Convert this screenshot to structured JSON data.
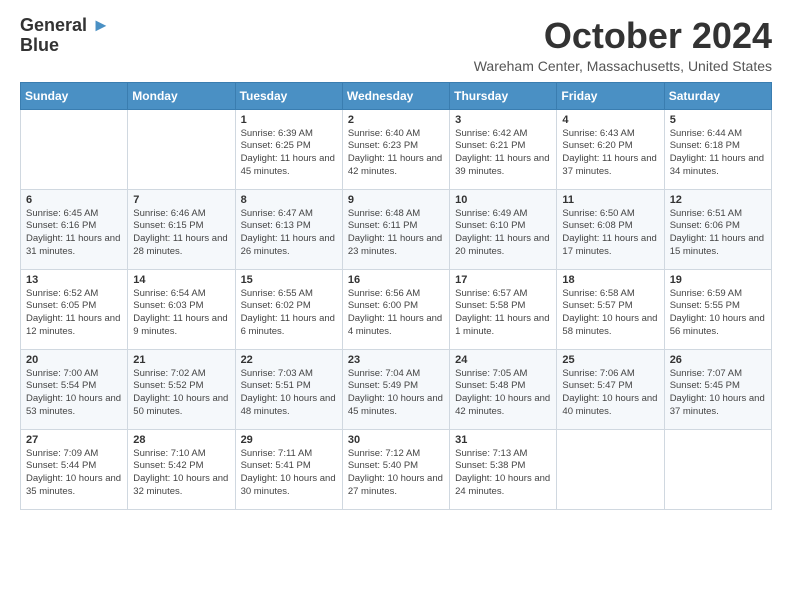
{
  "header": {
    "logo_line1": "General",
    "logo_line2": "Blue",
    "month": "October 2024",
    "location": "Wareham Center, Massachusetts, United States"
  },
  "days_of_week": [
    "Sunday",
    "Monday",
    "Tuesday",
    "Wednesday",
    "Thursday",
    "Friday",
    "Saturday"
  ],
  "weeks": [
    [
      {
        "day": "",
        "info": ""
      },
      {
        "day": "",
        "info": ""
      },
      {
        "day": "1",
        "info": "Sunrise: 6:39 AM\nSunset: 6:25 PM\nDaylight: 11 hours and 45 minutes."
      },
      {
        "day": "2",
        "info": "Sunrise: 6:40 AM\nSunset: 6:23 PM\nDaylight: 11 hours and 42 minutes."
      },
      {
        "day": "3",
        "info": "Sunrise: 6:42 AM\nSunset: 6:21 PM\nDaylight: 11 hours and 39 minutes."
      },
      {
        "day": "4",
        "info": "Sunrise: 6:43 AM\nSunset: 6:20 PM\nDaylight: 11 hours and 37 minutes."
      },
      {
        "day": "5",
        "info": "Sunrise: 6:44 AM\nSunset: 6:18 PM\nDaylight: 11 hours and 34 minutes."
      }
    ],
    [
      {
        "day": "6",
        "info": "Sunrise: 6:45 AM\nSunset: 6:16 PM\nDaylight: 11 hours and 31 minutes."
      },
      {
        "day": "7",
        "info": "Sunrise: 6:46 AM\nSunset: 6:15 PM\nDaylight: 11 hours and 28 minutes."
      },
      {
        "day": "8",
        "info": "Sunrise: 6:47 AM\nSunset: 6:13 PM\nDaylight: 11 hours and 26 minutes."
      },
      {
        "day": "9",
        "info": "Sunrise: 6:48 AM\nSunset: 6:11 PM\nDaylight: 11 hours and 23 minutes."
      },
      {
        "day": "10",
        "info": "Sunrise: 6:49 AM\nSunset: 6:10 PM\nDaylight: 11 hours and 20 minutes."
      },
      {
        "day": "11",
        "info": "Sunrise: 6:50 AM\nSunset: 6:08 PM\nDaylight: 11 hours and 17 minutes."
      },
      {
        "day": "12",
        "info": "Sunrise: 6:51 AM\nSunset: 6:06 PM\nDaylight: 11 hours and 15 minutes."
      }
    ],
    [
      {
        "day": "13",
        "info": "Sunrise: 6:52 AM\nSunset: 6:05 PM\nDaylight: 11 hours and 12 minutes."
      },
      {
        "day": "14",
        "info": "Sunrise: 6:54 AM\nSunset: 6:03 PM\nDaylight: 11 hours and 9 minutes."
      },
      {
        "day": "15",
        "info": "Sunrise: 6:55 AM\nSunset: 6:02 PM\nDaylight: 11 hours and 6 minutes."
      },
      {
        "day": "16",
        "info": "Sunrise: 6:56 AM\nSunset: 6:00 PM\nDaylight: 11 hours and 4 minutes."
      },
      {
        "day": "17",
        "info": "Sunrise: 6:57 AM\nSunset: 5:58 PM\nDaylight: 11 hours and 1 minute."
      },
      {
        "day": "18",
        "info": "Sunrise: 6:58 AM\nSunset: 5:57 PM\nDaylight: 10 hours and 58 minutes."
      },
      {
        "day": "19",
        "info": "Sunrise: 6:59 AM\nSunset: 5:55 PM\nDaylight: 10 hours and 56 minutes."
      }
    ],
    [
      {
        "day": "20",
        "info": "Sunrise: 7:00 AM\nSunset: 5:54 PM\nDaylight: 10 hours and 53 minutes."
      },
      {
        "day": "21",
        "info": "Sunrise: 7:02 AM\nSunset: 5:52 PM\nDaylight: 10 hours and 50 minutes."
      },
      {
        "day": "22",
        "info": "Sunrise: 7:03 AM\nSunset: 5:51 PM\nDaylight: 10 hours and 48 minutes."
      },
      {
        "day": "23",
        "info": "Sunrise: 7:04 AM\nSunset: 5:49 PM\nDaylight: 10 hours and 45 minutes."
      },
      {
        "day": "24",
        "info": "Sunrise: 7:05 AM\nSunset: 5:48 PM\nDaylight: 10 hours and 42 minutes."
      },
      {
        "day": "25",
        "info": "Sunrise: 7:06 AM\nSunset: 5:47 PM\nDaylight: 10 hours and 40 minutes."
      },
      {
        "day": "26",
        "info": "Sunrise: 7:07 AM\nSunset: 5:45 PM\nDaylight: 10 hours and 37 minutes."
      }
    ],
    [
      {
        "day": "27",
        "info": "Sunrise: 7:09 AM\nSunset: 5:44 PM\nDaylight: 10 hours and 35 minutes."
      },
      {
        "day": "28",
        "info": "Sunrise: 7:10 AM\nSunset: 5:42 PM\nDaylight: 10 hours and 32 minutes."
      },
      {
        "day": "29",
        "info": "Sunrise: 7:11 AM\nSunset: 5:41 PM\nDaylight: 10 hours and 30 minutes."
      },
      {
        "day": "30",
        "info": "Sunrise: 7:12 AM\nSunset: 5:40 PM\nDaylight: 10 hours and 27 minutes."
      },
      {
        "day": "31",
        "info": "Sunrise: 7:13 AM\nSunset: 5:38 PM\nDaylight: 10 hours and 24 minutes."
      },
      {
        "day": "",
        "info": ""
      },
      {
        "day": "",
        "info": ""
      }
    ]
  ]
}
